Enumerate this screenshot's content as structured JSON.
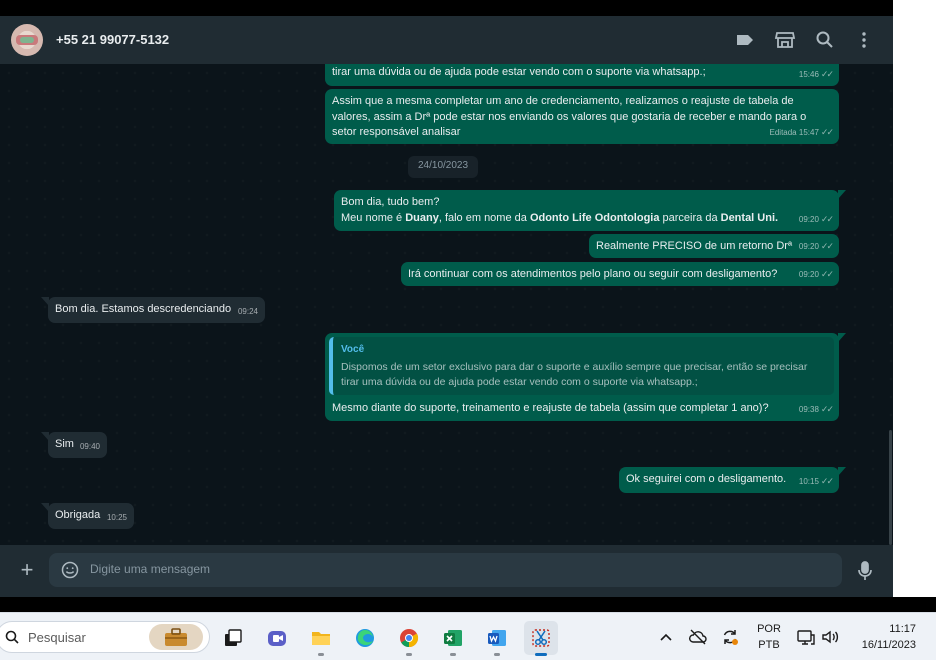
{
  "header": {
    "contact": "+55 21 99077-5132",
    "icons": [
      "label-icon",
      "store-icon",
      "search-icon",
      "menu-dots-icon"
    ]
  },
  "chat": {
    "date_chip": "24/10/2023",
    "messages": [
      {
        "dir": "out",
        "text": "tirar uma dúvida ou de ajuda pode estar vendo com o suporte via whatsapp.;",
        "time": "15:46"
      },
      {
        "dir": "out",
        "text": "Assim que a mesma completar um ano de credenciamento, realizamos o reajuste de tabela de valores, assim a Drª pode estar nos enviando os valores que gostaria de receber e mando para o setor responsável analisar",
        "time": "15:47",
        "edited": "Editada"
      },
      {
        "dir": "out",
        "line1": "Bom dia, tudo bem?",
        "p1": "Meu nome é ",
        "b1": "Duany",
        "p2": ", falo em nome da ",
        "b2": "Odonto Life Odontologia",
        "p3": " parceira da ",
        "b3": "Dental Uni.",
        "time": "09:20"
      },
      {
        "dir": "out",
        "text": "Realmente PRECISO de um retorno Drª",
        "time": "09:20"
      },
      {
        "dir": "out",
        "text": "Irá continuar com os atendimentos pelo plano ou seguir com desligamento?",
        "time": "09:20"
      },
      {
        "dir": "in",
        "text": "Bom dia. Estamos descredenciando",
        "time": "09:24"
      },
      {
        "dir": "out",
        "quote_author": "Você",
        "quote_text": "Dispomos de um setor exclusivo para dar o suporte e auxílio sempre que precisar, então se precisar tirar uma dúvida ou de ajuda pode estar vendo com o suporte via whatsapp.;",
        "text": "Mesmo diante do suporte, treinamento e reajuste de tabela (assim que completar 1 ano)?",
        "time": "09:38"
      },
      {
        "dir": "in",
        "text": "Sim",
        "time": "09:40"
      },
      {
        "dir": "out",
        "text": "Ok seguirei com o desligamento.",
        "time": "10:15"
      },
      {
        "dir": "in",
        "text": "Obrigada",
        "time": "10:25"
      }
    ]
  },
  "composer": {
    "placeholder": "Digite uma mensagem"
  },
  "taskbar": {
    "search_label": "Pesquisar",
    "apps": [
      "briefcase-icon",
      "task-view-icon",
      "teams-icon",
      "file-explorer-icon",
      "edge-icon",
      "chrome-icon",
      "excel-icon",
      "word-icon",
      "snipping-tool-icon"
    ],
    "lang_line1": "POR",
    "lang_line2": "PTB",
    "time": "11:17",
    "date": "16/11/2023"
  },
  "colors": {
    "outgoing": "#005c4b",
    "incoming": "#202c33",
    "background": "#0b141a",
    "accent_blue": "#53bdeb"
  }
}
